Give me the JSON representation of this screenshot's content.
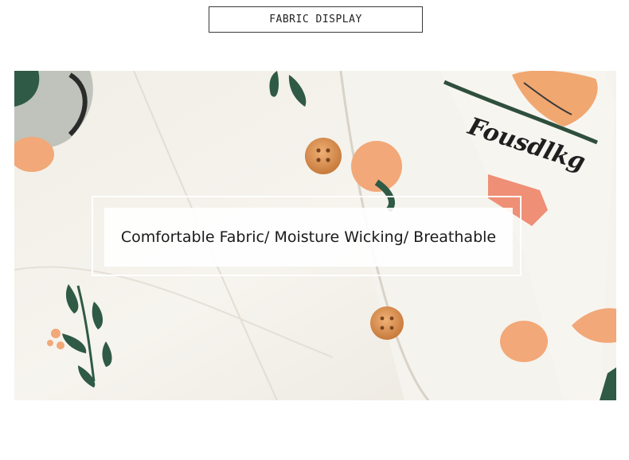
{
  "header": {
    "title": "FABRIC DISPLAY"
  },
  "photo": {
    "brand_print": "Fousdlkg",
    "caption": "Comfortable Fabric/ Moisture Wicking/ Breathable"
  },
  "colors": {
    "fabric": "#f3f0e9",
    "leaf_green": "#2f5a45",
    "peach": "#f2a878",
    "button_wood": "#d98a4a"
  }
}
